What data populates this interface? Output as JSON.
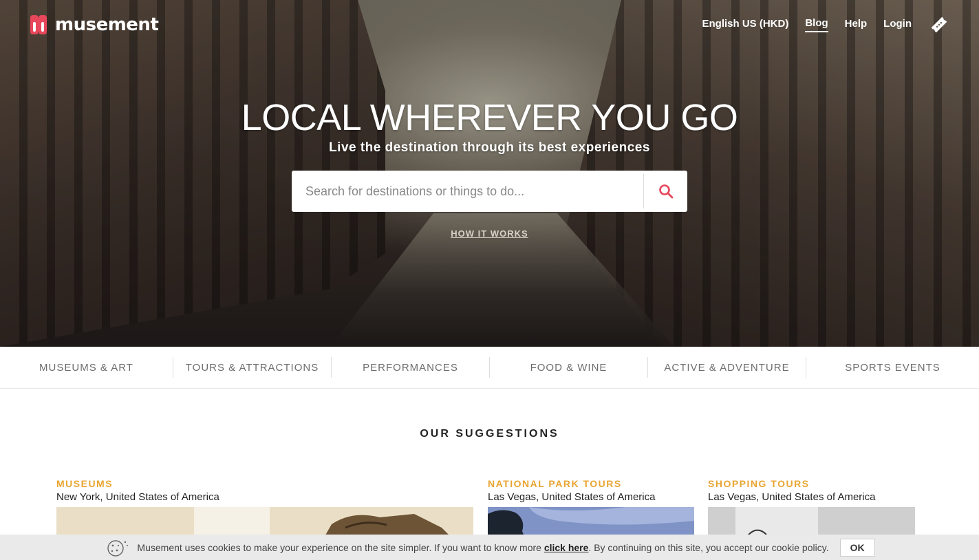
{
  "brand": {
    "name": "musement",
    "color": "#e8465b"
  },
  "topnav": {
    "language": "English US (HKD)",
    "blog": "Blog",
    "help": "Help",
    "login": "Login"
  },
  "hero": {
    "title": "LOCAL WHEREVER YOU GO",
    "subtitle": "Live the destination through its best experiences",
    "search_placeholder": "Search for destinations or things to do...",
    "how_it_works": "HOW IT WORKS"
  },
  "categories": [
    "MUSEUMS & ART",
    "TOURS & ATTRACTIONS",
    "PERFORMANCES",
    "FOOD & WINE",
    "ACTIVE & ADVENTURE",
    "SPORTS EVENTS"
  ],
  "suggestions": {
    "title": "OUR SUGGESTIONS",
    "cards": [
      {
        "category": "MUSEUMS",
        "location": "New York, United States of America"
      },
      {
        "category": "NATIONAL PARK TOURS",
        "location": "Las Vegas, United States of America"
      },
      {
        "category": "SHOPPING TOURS",
        "location": "Las Vegas, United States of America"
      }
    ]
  },
  "cookie": {
    "text_before": "Musement uses cookies to make your experience on the site simpler. If you want to know more ",
    "link": "click here",
    "text_after": ". By continuing on this site, you accept our cookie policy.",
    "ok": "OK"
  },
  "colors": {
    "accent": "#e8465b",
    "category_label": "#e8a532"
  }
}
